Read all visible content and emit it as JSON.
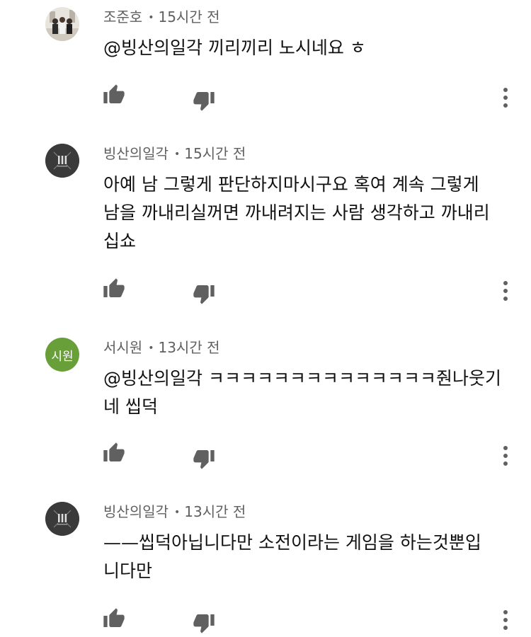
{
  "comments": [
    {
      "author": "조준호",
      "time": "15시간 전",
      "text": "@빙산의일각 끼리끼리 노시네요 ㅎ",
      "avatar": {
        "type": "photo"
      }
    },
    {
      "author": "빙산의일각",
      "time": "15시간 전",
      "text": "아예 남 그렇게 판단하지마시구요 혹여 계속 그렇게\n남을 까내리실꺼면 까내려지는 사람 생각하고 까내리\n십쇼",
      "avatar": {
        "type": "logo"
      }
    },
    {
      "author": "서시원",
      "time": "13시간 전",
      "text": "@빙산의일각 ㅋㅋㅋㅋㅋㅋㅋㅋㅋㅋㅋㅋㅋㅋ줜나웃기\n네 씹덕",
      "avatar": {
        "type": "initials",
        "initials": "시원",
        "color": "#689f38"
      }
    },
    {
      "author": "빙산의일각",
      "time": "13시간 전",
      "text": "——씹덕아닙니다만 소전이라는 게임을 하는것뿐입\n니다만",
      "avatar": {
        "type": "logo"
      }
    }
  ],
  "icons": {
    "like": "thumbs-up-icon",
    "dislike": "thumbs-down-icon",
    "more": "more-vertical-icon"
  },
  "colors": {
    "text": "#111111",
    "meta": "#606060",
    "icon": "#606060",
    "avatar_green": "#689f38"
  }
}
